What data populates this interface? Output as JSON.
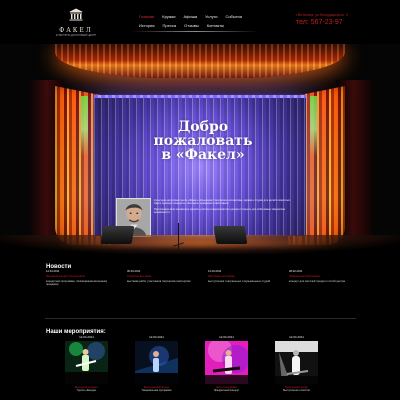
{
  "header": {
    "logo": {
      "icon_name": "theater-building-icon",
      "title": "ФАКЕЛ",
      "subtitle": "КУЛЬТУРНО-ДОСУГОВЫЙ ЦЕНТР"
    },
    "nav": [
      {
        "label": "Главная",
        "active": true
      },
      {
        "label": "Кружки",
        "active": false
      },
      {
        "label": "Афиша",
        "active": false
      },
      {
        "label": "Услуги",
        "active": false
      },
      {
        "label": "События",
        "active": false
      },
      {
        "label": "История",
        "active": false
      },
      {
        "label": "Пресса",
        "active": false
      },
      {
        "label": "Отзывы",
        "active": false
      },
      {
        "label": "Контакты",
        "active": false
      }
    ],
    "address": "г.Воткинск, ул.Володарского, 2",
    "phone": "тел: 567-23-97"
  },
  "hero": {
    "title_line1": "Добро пожаловать",
    "title_line2": "в «Факел»",
    "portrait_alt": "portrait-photo",
    "bio_paragraph1": "Культурно-досуговый центр «Факел» объединяет творческие коллективы, кружки и студии для детей и взрослых. Здесь проходят концерты, спектакли, праздники и фестивали.",
    "bio_paragraph2": "Приглашаем всех желающих принять участие в мероприятиях центра и открыть для себя новые творческие возможности."
  },
  "news": {
    "title": "Новости",
    "items": [
      {
        "date": "12.04.2011",
        "headline": "Весенний концерт коллективов",
        "text": "концертная программа, посвящённая весеннему празднику"
      },
      {
        "date": "30.03.2011",
        "headline": "Открытие выставки",
        "text": "выставка работ участников творческих мастерских"
      },
      {
        "date": "12.03.2011",
        "headline": "Фестиваль молодёжи",
        "text": "выступления театральных и музыкальных студий"
      },
      {
        "date": "28.02.2011",
        "headline": "Праздничная программа",
        "text": "концерт для жителей города и гостей центра"
      }
    ]
  },
  "events": {
    "title": "Наши мероприятия:",
    "items": [
      {
        "date": "12.04.2011",
        "image_name": "concert-guitarist-image",
        "link": "Весенний концерт",
        "desc": "Группа «Звезда»"
      },
      {
        "date": "12.04.2011",
        "image_name": "blue-stage-image",
        "link": "Молодёжный вечер",
        "desc": "Танцевальная программа"
      },
      {
        "date": "12.04.2011",
        "image_name": "pink-stage-image",
        "link": "Шоу-программа",
        "desc": "Праздничный концерт"
      },
      {
        "date": "12.04.2011",
        "image_name": "black-white-performer-image",
        "link": "Творческий вечер",
        "desc": "Выступление солистов"
      }
    ]
  },
  "colors": {
    "accent_red": "#c91919",
    "background": "#000000",
    "stage_purple": "#6e55d7",
    "curtain_orange": "#ff8a13"
  }
}
